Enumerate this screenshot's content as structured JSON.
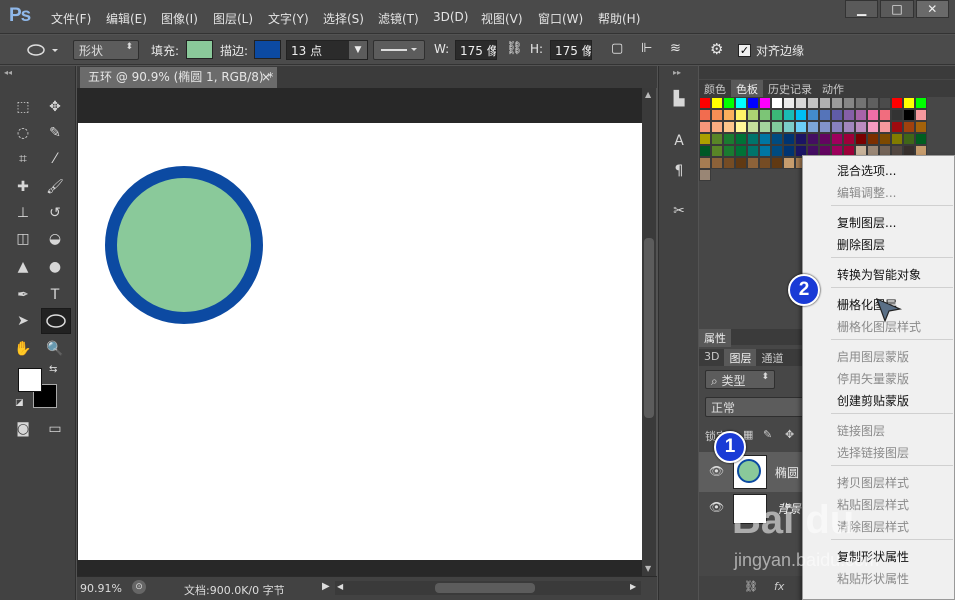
{
  "app": {
    "logo": "Ps"
  },
  "menu": [
    "文件(F)",
    "编辑(E)",
    "图像(I)",
    "图层(L)",
    "文字(Y)",
    "选择(S)",
    "滤镜(T)",
    "3D(D)",
    "视图(V)",
    "窗口(W)",
    "帮助(H)"
  ],
  "window_controls": {
    "minimize": "▁",
    "maximize": "□",
    "close": "✕"
  },
  "options": {
    "mode": "形状",
    "fill_label": "填充:",
    "fill_color": "#8ac99a",
    "stroke_label": "描边:",
    "stroke_color": "#0c4aa2",
    "stroke_size": "13 点",
    "w_label": "W:",
    "w_value": "175 像",
    "h_label": "H:",
    "h_value": "175 像",
    "align_edges": "对齐边缘"
  },
  "document": {
    "tab_title": "五环 @ 90.9% (椭圆 1, RGB/8) *",
    "close": "×"
  },
  "shape": {
    "fill": "#8ac99a",
    "stroke": "#0c4aa2"
  },
  "status": {
    "zoom": "90.91%",
    "doc_info": "文档:900.0K/0 字节"
  },
  "panels": {
    "swatch_tabs": [
      "颜色",
      "色板",
      "历史记录",
      "动作"
    ],
    "props_tab": "属性",
    "layer_tabs": [
      "3D",
      "图层",
      "通道"
    ],
    "kind_filter": "类型",
    "blend_mode": "正常",
    "lock_label": "锁定:",
    "layers": [
      {
        "name": "椭圆"
      },
      {
        "name": "背景"
      }
    ]
  },
  "swatch_colors": [
    "#ff0000",
    "#ffff00",
    "#00ff00",
    "#00ffff",
    "#0000ff",
    "#ff00ff",
    "#ffffff",
    "#ebebeb",
    "#d7d7d7",
    "#c3c3c3",
    "#afafaf",
    "#9b9b9b",
    "#878787",
    "#737373",
    "#5f5f5f",
    "#4b4b4b",
    "#ff0000",
    "#ffff00",
    "#00ff00",
    "#f26c4f",
    "#f68e55",
    "#fbaf5c",
    "#fff467",
    "#acd372",
    "#7cc576",
    "#3bb878",
    "#1abbb4",
    "#00bff3",
    "#438ccb",
    "#5574b9",
    "#605ca8",
    "#855fa8",
    "#a763a9",
    "#ef6ea8",
    "#f16d7e",
    "#333333",
    "#000000",
    "#f5989d",
    "#f7977a",
    "#f9ad81",
    "#fdc68c",
    "#fff799",
    "#c6df9c",
    "#a4d49d",
    "#81ca9d",
    "#7bcdc9",
    "#6ccff7",
    "#7ca6d8",
    "#8293ca",
    "#8881be",
    "#a286bd",
    "#bc8cbf",
    "#f49bc1",
    "#f5999d",
    "#9e0b0f",
    "#a0410d",
    "#a3620a",
    "#aba000",
    "#598527",
    "#1a7b30",
    "#007236",
    "#00746b",
    "#0076a3",
    "#004b80",
    "#003471",
    "#1b1464",
    "#440e62",
    "#630460",
    "#9e005d",
    "#9e0039",
    "#790000",
    "#7b2e00",
    "#7d4900",
    "#827b00",
    "#406618",
    "#005e20",
    "#005826",
    "#598527",
    "#1a7b30",
    "#007236",
    "#00746b",
    "#0076a3",
    "#004b80",
    "#003471",
    "#1b1464",
    "#440e62",
    "#630460",
    "#9e005d",
    "#9e0039",
    "#c7b299",
    "#998675",
    "#736357",
    "#534741",
    "#37302d",
    "#c69c6d",
    "#a67c52",
    "#8c6239",
    "#754c24",
    "#603913",
    "#8c6239",
    "#754c24",
    "#603913",
    "#c69c6d",
    "#a67c52",
    "#998675",
    "#736357",
    "#534741",
    "#37302d",
    "#c7b299",
    "#8c6239",
    "#754c24",
    "#603913",
    "#c69c6d",
    "#a67c52",
    "#998675"
  ],
  "context_menu": {
    "items": [
      {
        "label": "混合选项...",
        "enabled": true
      },
      {
        "label": "编辑调整...",
        "enabled": false
      },
      {
        "label": "复制图层...",
        "enabled": true
      },
      {
        "label": "删除图层",
        "enabled": true
      },
      {
        "label": "转换为智能对象",
        "enabled": true
      },
      {
        "label": "栅格化图层",
        "enabled": true
      },
      {
        "label": "栅格化图层样式",
        "enabled": false
      },
      {
        "label": "启用图层蒙版",
        "enabled": false
      },
      {
        "label": "停用矢量蒙版",
        "enabled": false
      },
      {
        "label": "创建剪贴蒙版",
        "enabled": true
      },
      {
        "label": "链接图层",
        "enabled": false
      },
      {
        "label": "选择链接图层",
        "enabled": false
      },
      {
        "label": "拷贝图层样式",
        "enabled": false
      },
      {
        "label": "粘贴图层样式",
        "enabled": false
      },
      {
        "label": "清除图层样式",
        "enabled": false
      },
      {
        "label": "复制形状属性",
        "enabled": true
      },
      {
        "label": "粘贴形状属性",
        "enabled": false
      }
    ]
  },
  "annotations": {
    "step1": "1",
    "step2": "2"
  },
  "watermark": {
    "brand": "Bai du",
    "url": "jingyan.baidu.com"
  }
}
